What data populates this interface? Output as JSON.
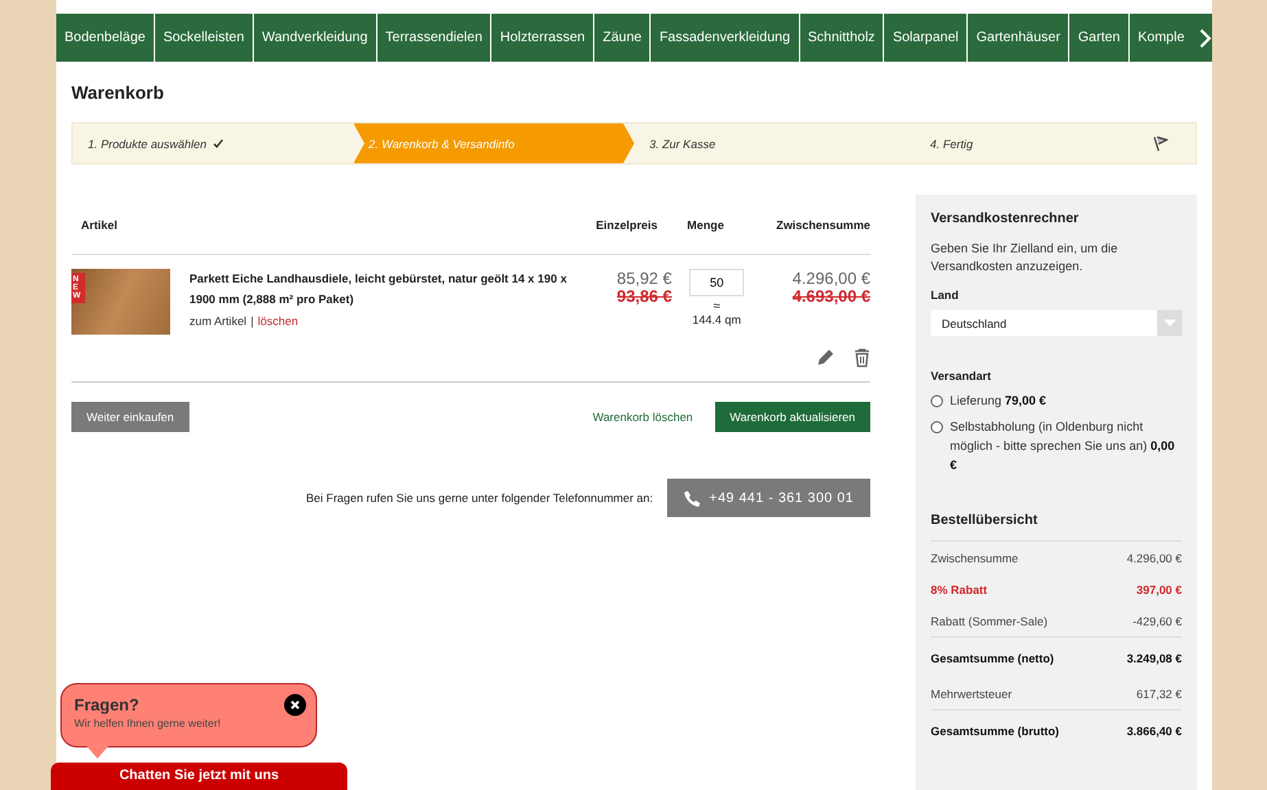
{
  "nav": {
    "items": [
      "Bodenbeläge",
      "Sockelleisten",
      "Wandverkleidung",
      "Terrassendielen",
      "Holzterrassen",
      "Zäune",
      "Fassadenverkleidung",
      "Schnittholz",
      "Solarpanel",
      "Gartenhäuser",
      "Garten",
      "Komple"
    ]
  },
  "page_title": "Warenkorb",
  "steps": [
    {
      "label": "1. Produkte auswählen",
      "selected": false,
      "done": true
    },
    {
      "label": "2. Warenkorb & Versandinfo",
      "selected": true,
      "done": false
    },
    {
      "label": "3. Zur Kasse",
      "selected": false,
      "done": false
    },
    {
      "label": "4. Fertig",
      "selected": false,
      "done": false
    }
  ],
  "cart": {
    "columns": [
      "Artikel",
      "Einzelpreis",
      "Menge",
      "Zwischensumme"
    ],
    "items": [
      {
        "badge": "NEW",
        "title": "Parkett Eiche Landhausdiele, leicht gebürstet, natur geölt 14 x 190 x 1900 mm (2,888 m² pro Paket)",
        "link": "zum Artikel",
        "separator": "|",
        "delete": "löschen",
        "price": "85,92 €",
        "old_price": "93,86 €",
        "quantity": "50",
        "approx": "≈",
        "area": "144.4 qm",
        "subtotal": "4.296,00 €",
        "old_subtotal": "4.693,00 €"
      }
    ],
    "continue_button": "Weiter einkaufen",
    "clear_button": "Warenkorb löschen",
    "update_button": "Warenkorb aktualisieren"
  },
  "contact": {
    "text": "Bei Fragen rufen Sie uns gerne unter folgender Telefonnummer an:",
    "phone": "+49 441 - 361 300 01"
  },
  "shipping": {
    "title": "Versandkostenrechner",
    "text": "Geben Sie Ihr Zielland ein, um die Versandkosten anzuzeigen.",
    "country_label": "Land",
    "country": "Deutschland",
    "method_label": "Versandart",
    "options": [
      {
        "label": "Lieferung",
        "price": "79,00 €",
        "selected": false
      },
      {
        "label": "Selbstabholung (in Oldenburg nicht möglich - bitte sprechen Sie uns an)",
        "price": "0,00 €",
        "selected": false
      }
    ]
  },
  "summary": {
    "title": "Bestellübersicht",
    "rows": [
      {
        "label": "Zwischensumme",
        "value": "4.296,00 €",
        "kind": "normal"
      },
      {
        "label": "8% Rabatt",
        "value": "397,00 €",
        "kind": "discount"
      },
      {
        "label": "Rabatt (Sommer-Sale)",
        "value": "-429,60 €",
        "kind": "normal"
      },
      {
        "label": "Gesamtsumme (netto)",
        "value": "3.249,08 €",
        "kind": "total"
      },
      {
        "label": "Mehrwertsteuer",
        "value": "617,32 €",
        "kind": "normal"
      },
      {
        "label": "Gesamtsumme (brutto)",
        "value": "3.866,40 €",
        "kind": "total"
      }
    ]
  },
  "chat": {
    "title": "Fragen?",
    "text": "Wir helfen Ihnen gerne weiter!",
    "button": "Chatten Sie jetzt mit uns"
  }
}
